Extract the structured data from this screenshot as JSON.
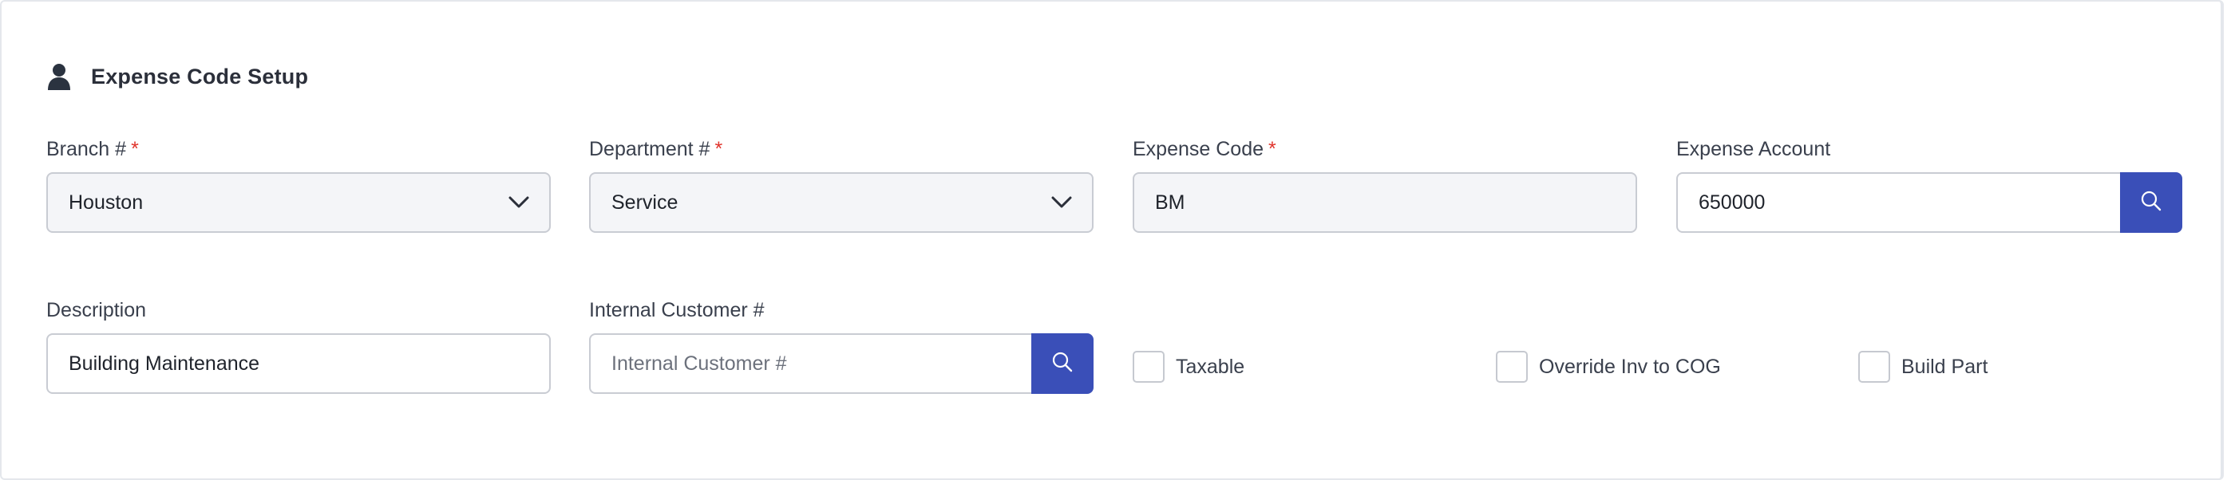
{
  "section": {
    "title": "Expense Code Setup",
    "icon": "user-icon"
  },
  "fields": {
    "branch": {
      "label": "Branch #",
      "required_mark": "*",
      "value": "Houston"
    },
    "department": {
      "label": "Department #",
      "required_mark": "*",
      "value": "Service"
    },
    "expense_code": {
      "label": "Expense Code",
      "required_mark": "*",
      "value": "BM"
    },
    "expense_account": {
      "label": "Expense Account",
      "value": "650000"
    },
    "description": {
      "label": "Description",
      "value": "Building Maintenance"
    },
    "internal_customer": {
      "label": "Internal Customer #",
      "value": "",
      "placeholder": "Internal Customer #"
    }
  },
  "checkboxes": [
    {
      "label": "Taxable",
      "checked": false
    },
    {
      "label": "Override Inv to COG",
      "checked": false
    },
    {
      "label": "Build Part",
      "checked": false
    }
  ],
  "colors": {
    "accent": "#3a4fb8",
    "required": "#e0342c",
    "input_bg_readonly": "#f4f5f8"
  }
}
